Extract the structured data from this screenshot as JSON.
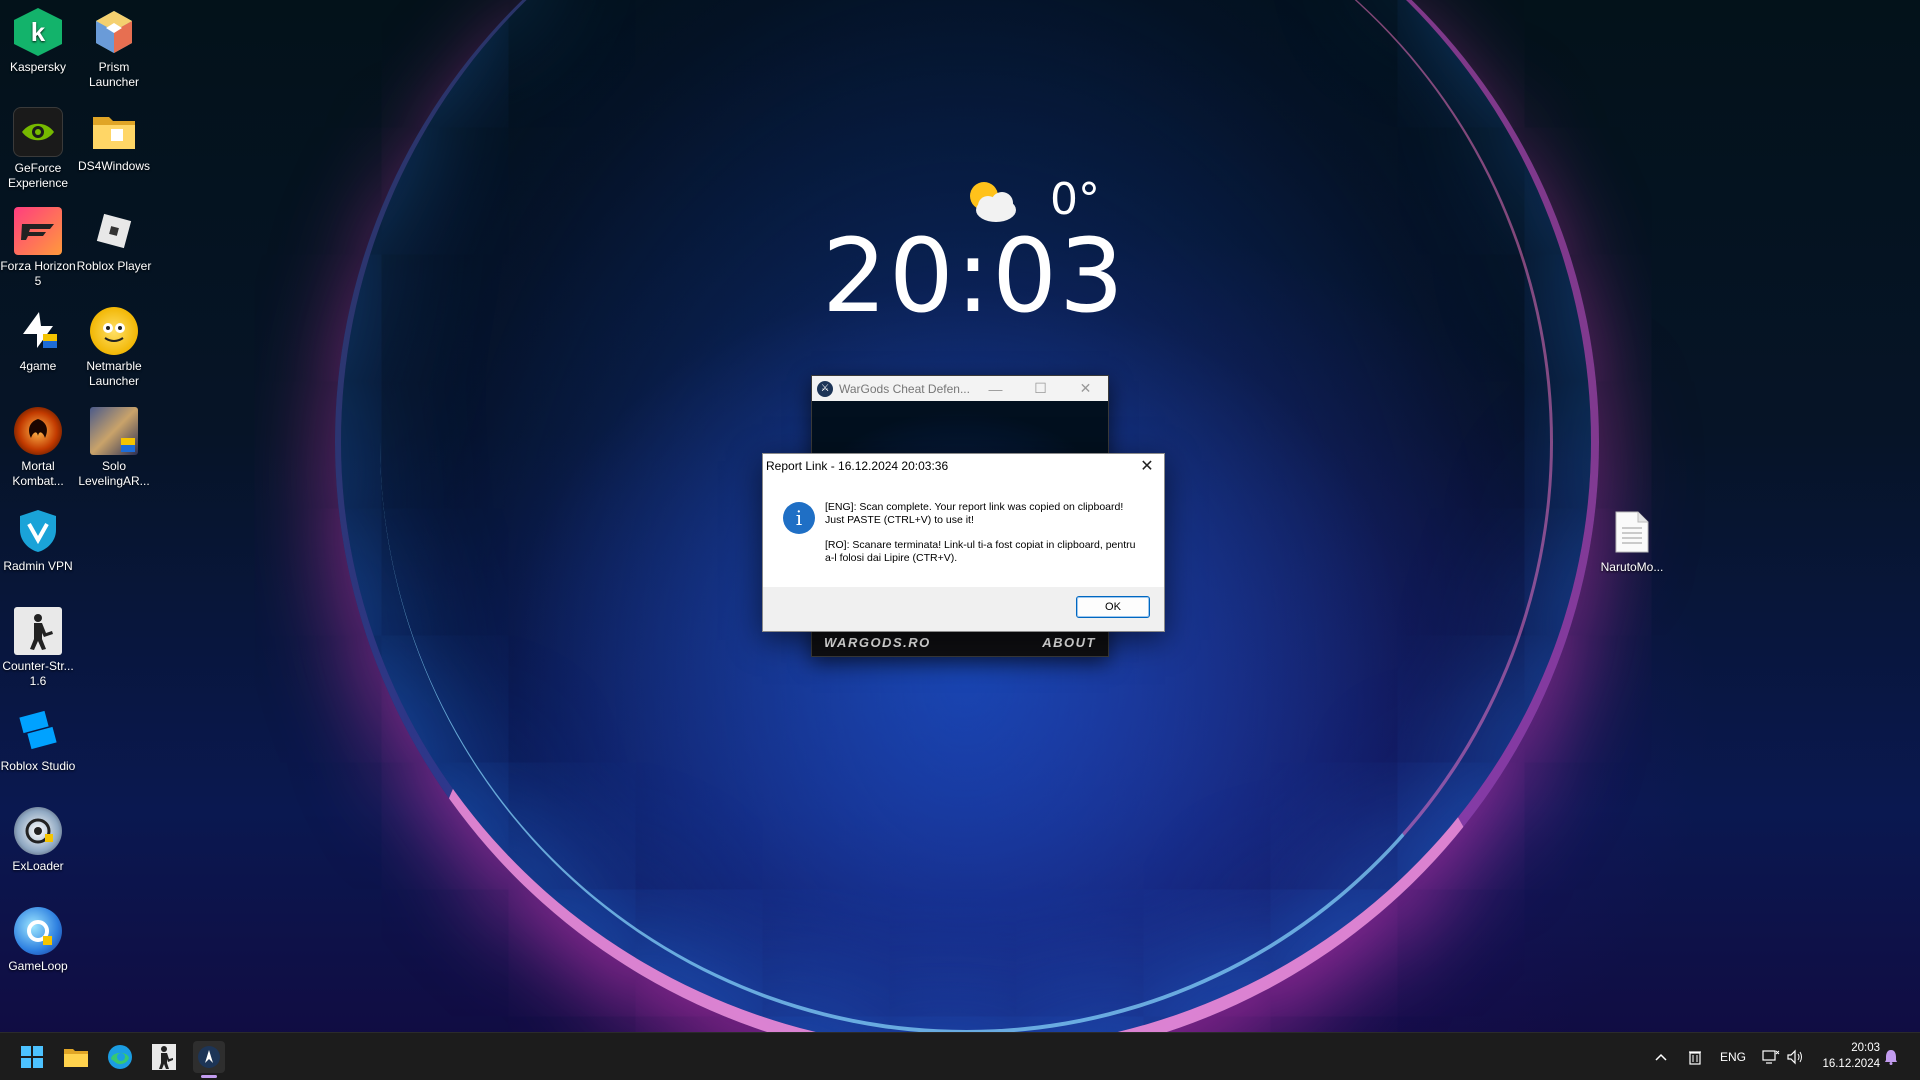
{
  "desktop": {
    "icons": [
      {
        "label": "Kaspersky"
      },
      {
        "label": "Prism Launcher"
      },
      {
        "label": "GeForce Experience"
      },
      {
        "label": "DS4Windows"
      },
      {
        "label": "Forza Horizon 5"
      },
      {
        "label": "Roblox Player"
      },
      {
        "label": "4game"
      },
      {
        "label": "Netmarble Launcher"
      },
      {
        "label": "Mortal Kombat..."
      },
      {
        "label": "Solo LevelingAR..."
      },
      {
        "label": "Radmin VPN"
      },
      {
        "label": "Counter-Str... 1.6"
      },
      {
        "label": "Roblox Studio"
      },
      {
        "label": "ExLoader"
      },
      {
        "label": "GameLoop"
      },
      {
        "label": "NarutoMo..."
      }
    ]
  },
  "widget": {
    "temperature": "0°",
    "time": "20:03",
    "weather_icon": "partly-cloudy-icon"
  },
  "wargods_window": {
    "title": "WarGods Cheat Defen...",
    "footer_left": "WARGODS.RO",
    "footer_right": "ABOUT"
  },
  "dialog": {
    "title": "Report Link - 16.12.2024 20:03:36",
    "message_eng": "[ENG]: Scan complete. Your report link was copied on clipboard! Just PASTE (CTRL+V) to use it!",
    "message_ro": "[RO]: Scanare terminata! Link-ul ti-a fost copiat in clipboard, pentru a-l folosi dai Lipire (CTR+V).",
    "ok_label": "OK",
    "icon": "info-icon"
  },
  "taskbar": {
    "language": "ENG",
    "time": "20:03",
    "date": "16.12.2024",
    "accent": "#c39cf0"
  }
}
